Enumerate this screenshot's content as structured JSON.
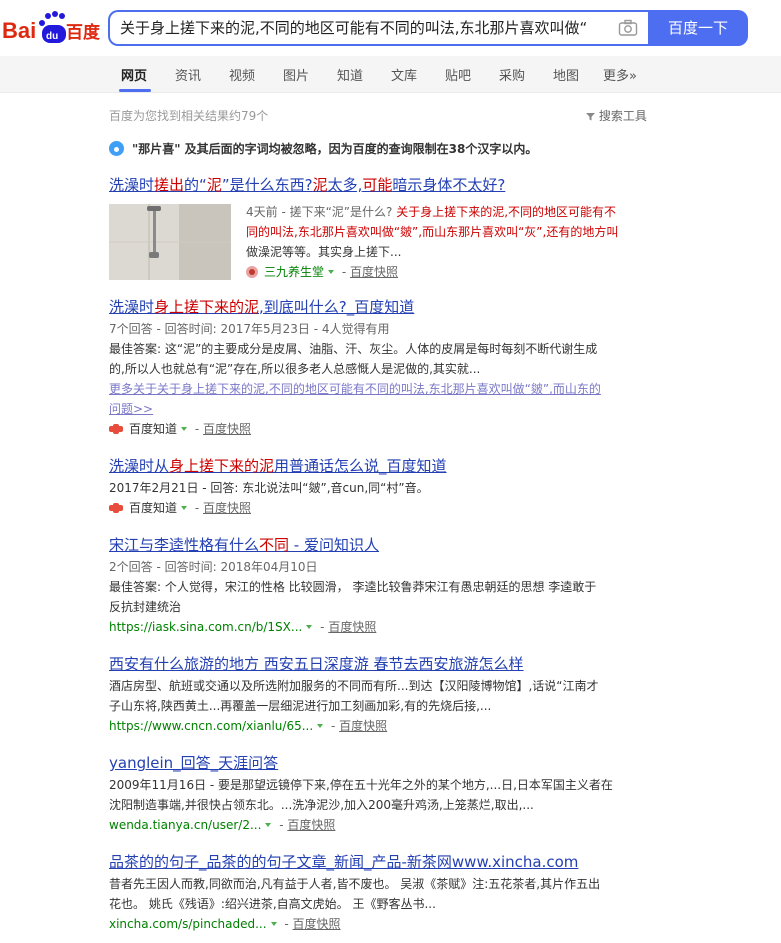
{
  "logo": {
    "text": "Bai百度",
    "brand_red": "#de2910",
    "brand_blue": "#2319dc"
  },
  "search": {
    "query": "关于身上搓下来的泥,不同的地区可能有不同的叫法,东北那片喜欢叫做“",
    "button_label": "百度一下"
  },
  "tabs": [
    {
      "label": "网页",
      "active": true
    },
    {
      "label": "资讯"
    },
    {
      "label": "视频"
    },
    {
      "label": "图片"
    },
    {
      "label": "知道"
    },
    {
      "label": "文库"
    },
    {
      "label": "贴吧"
    },
    {
      "label": "采购"
    },
    {
      "label": "地图"
    },
    {
      "label": "更多»"
    }
  ],
  "result_count": "百度为您找到相关结果约79个",
  "search_tools": "搜索工具",
  "notice": "\"那片喜\" 及其后面的字词均被忽略，因为百度的查询限制在38个汉字以内。",
  "results": [
    {
      "title_parts": [
        "洗澡时",
        "搓出",
        "的“",
        "泥",
        "”是什么东西?",
        "泥",
        "太多,",
        "可能",
        "暗示身体不太好?"
      ],
      "lines": [
        "4天前 - 搓下来“泥”是什么? ",
        "关于身上搓下来的泥,不同的地区可能有不",
        "同的叫法,东北那片喜欢叫做“皴”,而山东那片喜欢叫“灰”,还有的地方叫",
        "做澡泥等等。其实身上搓下..."
      ],
      "site": "三九养生堂",
      "kuaizhao": "百度快照"
    },
    {
      "title_parts": [
        "洗澡时",
        "身上搓下来的泥",
        ",到底叫什么?_百度知道"
      ],
      "meta": "7个回答 - 回答时间: 2017年5月23日 - 4人觉得有用",
      "lines": [
        "最佳答案: 这“泥”的主要成分是皮屑、油脂、汗、灰尘。人体的皮屑是每时每刻不断代谢生成",
        "的,所以人也就总有“泥”存在,所以很多老人总感慨人是泥做的,其实就..."
      ],
      "more_link": [
        "更多关于关于身上搓下来的泥,不同的地区可能有不同的叫法,东北那片喜欢叫做“皴”,而山东的",
        "问题>>"
      ],
      "site": "百度知道",
      "kuaizhao": "百度快照"
    },
    {
      "title_parts": [
        "洗澡时从",
        "身上搓下来的泥",
        "用普通话怎么说_百度知道"
      ],
      "lines": [
        "2017年2月21日 - 回答: 东北说法叫“皴”,音cun,同“村”音。"
      ],
      "site": "百度知道",
      "kuaizhao": "百度快照"
    },
    {
      "title_parts": [
        "宋江与李逵性格有什么",
        "不同",
        " - 爱问知识人"
      ],
      "meta": "2个回答 - 回答时间: 2018年04月10日",
      "lines": [
        "最佳答案: 个人觉得，宋江的性格 比较圆滑， 李逵比较鲁莽宋江有愚忠朝廷的思想 李逵敢于",
        "反抗封建统治"
      ],
      "url": "https://iask.sina.com.cn/b/1SX...",
      "kuaizhao": "百度快照"
    },
    {
      "title_parts": [
        "西安有什么旅游的地方 西安五日深度游 春节去西安旅游怎么样"
      ],
      "lines": [
        "酒店房型、航班或交通以及所选附加服务的不同而有所...到达【汉阳陵博物馆】,话说“江南才",
        "子山东将,陕西黄土...再覆盖一层细泥进行加工刻画加彩,有的先烧后接,..."
      ],
      "url": "https://www.cncn.com/xianlu/65...",
      "kuaizhao": "百度快照"
    },
    {
      "title_parts": [
        "yanglein_回答_天涯问答"
      ],
      "lines": [
        "2009年11月16日 - 要是那望远镜停下来,停在五十光年之外的某个地方,...日,日本军国主义者在",
        "沈阳制造事端,并很快占领东北。...洗净泥沙,加入200毫升鸡汤,上笼蒸烂,取出,..."
      ],
      "url": "wenda.tianya.cn/user/2...",
      "kuaizhao": "百度快照"
    },
    {
      "title_parts": [
        "品茶的的句子_品茶的的句子文章_新闻_产品-新茶网www.xincha.com"
      ],
      "lines": [
        "昔者先王因人而教,同欲而治,凡有益于人者,皆不废也。 吴淑《茶赋》注:五花茶者,其片作五出",
        "花也。 姚氏《残语》:绍兴进茶,自高文虎始。 王《野客丛书..."
      ],
      "url": "xincha.com/s/pinchaded...",
      "kuaizhao": "百度快照"
    }
  ]
}
